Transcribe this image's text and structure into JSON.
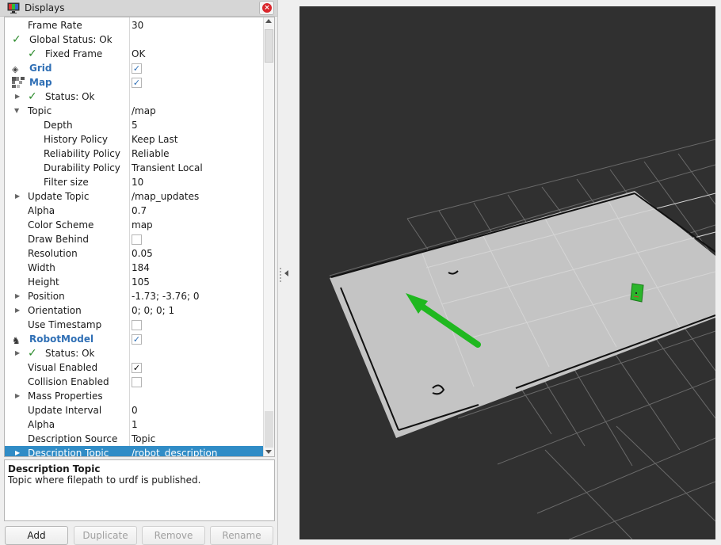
{
  "panel": {
    "title": "Displays",
    "icon": "monitor-icon",
    "close_icon": "close-icon"
  },
  "tree": {
    "rows": [
      {
        "label": "Frame Rate",
        "value": "30"
      },
      {
        "label": "Global Status: Ok",
        "value": ""
      },
      {
        "label": "Fixed Frame",
        "value": "OK"
      },
      {
        "label": "Grid",
        "value": ""
      },
      {
        "label": "Map",
        "value": ""
      },
      {
        "label": "Status: Ok",
        "value": ""
      },
      {
        "label": "Topic",
        "value": "/map"
      },
      {
        "label": "Depth",
        "value": "5"
      },
      {
        "label": "History Policy",
        "value": "Keep Last"
      },
      {
        "label": "Reliability Policy",
        "value": "Reliable"
      },
      {
        "label": "Durability Policy",
        "value": "Transient Local"
      },
      {
        "label": "Filter size",
        "value": "10"
      },
      {
        "label": "Update Topic",
        "value": "/map_updates"
      },
      {
        "label": "Alpha",
        "value": "0.7"
      },
      {
        "label": "Color Scheme",
        "value": "map"
      },
      {
        "label": "Draw Behind",
        "value": ""
      },
      {
        "label": "Resolution",
        "value": "0.05"
      },
      {
        "label": "Width",
        "value": "184"
      },
      {
        "label": "Height",
        "value": "105"
      },
      {
        "label": "Position",
        "value": "-1.73; -3.76; 0"
      },
      {
        "label": "Orientation",
        "value": "0; 0; 0; 1"
      },
      {
        "label": "Use Timestamp",
        "value": ""
      },
      {
        "label": "RobotModel",
        "value": ""
      },
      {
        "label": "Status: Ok",
        "value": ""
      },
      {
        "label": "Visual Enabled",
        "value": ""
      },
      {
        "label": "Collision Enabled",
        "value": ""
      },
      {
        "label": "Mass Properties",
        "value": ""
      },
      {
        "label": "Update Interval",
        "value": "0"
      },
      {
        "label": "Alpha",
        "value": "1"
      },
      {
        "label": "Description Source",
        "value": "Topic"
      },
      {
        "label": "Description Topic",
        "value": "/robot_description"
      }
    ],
    "checkboxes": {
      "grid_enabled": true,
      "map_enabled": true,
      "draw_behind": false,
      "use_timestamp": false,
      "robotmodel_enabled": true,
      "visual_enabled": true,
      "collision_enabled": false
    },
    "check_glyph": "✓",
    "selected_row": "Description Topic"
  },
  "description": {
    "title": "Description Topic",
    "text": "Topic where filepath to urdf is published."
  },
  "buttons": {
    "add": "Add",
    "duplicate": "Duplicate",
    "remove": "Remove",
    "rename": "Rename"
  },
  "viewport": {
    "background": "#303030",
    "map_color": "#c4c4c4",
    "arrow_color": "#1fb81f",
    "robot_color": "#2bb52b"
  }
}
